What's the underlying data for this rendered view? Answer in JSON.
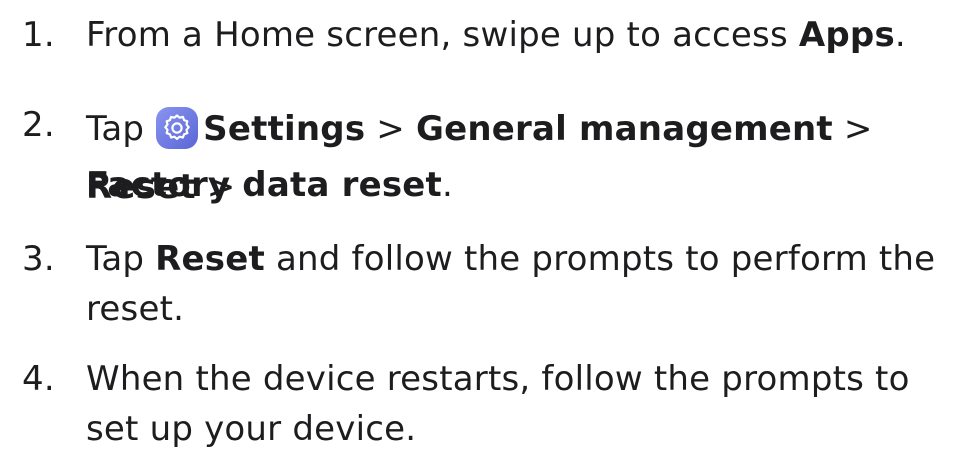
{
  "steps": [
    {
      "number": "1.",
      "part1": "From a Home screen, swipe up to access ",
      "bold1": "Apps",
      "part2": "."
    },
    {
      "number": "2.",
      "part1": "Tap ",
      "icon": "settings-gear-icon",
      "icon_color": "#6f7de0",
      "bold1": "Settings",
      "sep1": " > ",
      "bold2": "General management",
      "sep2": " > ",
      "bold3": "Reset",
      "sep3": " >",
      "bold4": "Factory data reset",
      "part2": "."
    },
    {
      "number": "3.",
      "part1": "Tap ",
      "bold1": "Reset",
      "part2": " and follow the prompts to perform the",
      "line2": "reset."
    },
    {
      "number": "4.",
      "line1": "When the device restarts, follow the prompts to",
      "line2": "set up your device."
    }
  ]
}
